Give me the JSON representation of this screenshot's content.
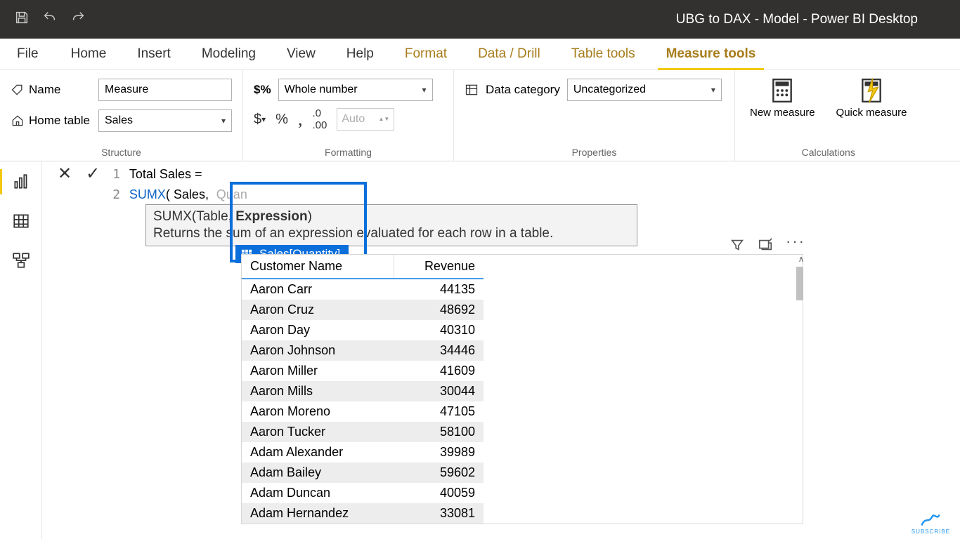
{
  "titlebar": {
    "title": "UBG to DAX - Model - Power BI Desktop"
  },
  "tabs": {
    "file": "File",
    "items": [
      "Home",
      "Insert",
      "Modeling",
      "View",
      "Help"
    ],
    "context": [
      "Format",
      "Data / Drill",
      "Table tools",
      "Measure tools"
    ],
    "active": "Measure tools"
  },
  "ribbon": {
    "structure": {
      "name_label": "Name",
      "name_value": "Measure",
      "home_table_label": "Home table",
      "home_table_value": "Sales",
      "group": "Structure"
    },
    "formatting": {
      "format_value": "Whole number",
      "currency": "$",
      "percent": "%",
      "comma": ",",
      "decimals": ".00",
      "auto": "Auto",
      "group": "Formatting"
    },
    "properties": {
      "category_label": "Data category",
      "category_value": "Uncategorized",
      "group": "Properties"
    },
    "calculations": {
      "new_measure": "New measure",
      "quick_measure": "Quick measure",
      "group": "Calculations"
    }
  },
  "formula": {
    "line1_no": "1",
    "line1": "Total Sales =",
    "line2_no": "2",
    "line2_func": "SUMX",
    "line2_rest": "( Sales,",
    "ghost": "Quan"
  },
  "intellisense": {
    "sig_pre": "SUMX(Table, ",
    "sig_cur": "Expression",
    "sig_post": ")",
    "desc": "Returns the sum of an expression evaluated for each row in a table.",
    "item": "Sales[Quantity]"
  },
  "table": {
    "headers": {
      "name": "Customer Name",
      "rev": "Revenue"
    },
    "rows": [
      {
        "name": "Aaron Carr",
        "rev": "44135"
      },
      {
        "name": "Aaron Cruz",
        "rev": "48692"
      },
      {
        "name": "Aaron Day",
        "rev": "40310"
      },
      {
        "name": "Aaron Johnson",
        "rev": "34446"
      },
      {
        "name": "Aaron Miller",
        "rev": "41609"
      },
      {
        "name": "Aaron Mills",
        "rev": "30044"
      },
      {
        "name": "Aaron Moreno",
        "rev": "47105"
      },
      {
        "name": "Aaron Tucker",
        "rev": "58100"
      },
      {
        "name": "Adam Alexander",
        "rev": "39989"
      },
      {
        "name": "Adam Bailey",
        "rev": "59602"
      },
      {
        "name": "Adam Duncan",
        "rev": "40059"
      },
      {
        "name": "Adam Hernandez",
        "rev": "33081"
      }
    ]
  },
  "subscribe": "SUBSCRIBE"
}
